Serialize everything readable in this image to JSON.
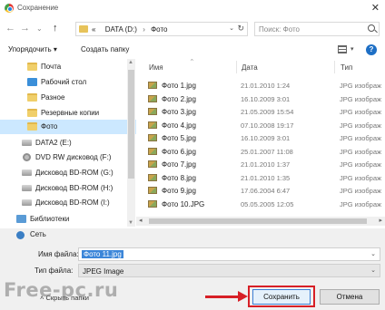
{
  "window": {
    "title": "Сохранение",
    "close_glyph": "✕"
  },
  "nav": {
    "back_glyph": "←",
    "forward_glyph": "→",
    "history_glyph": "⌄",
    "up_glyph": "↑",
    "address": {
      "prefix": "«",
      "segments": [
        "DATA (D:)",
        "Фото"
      ],
      "separator": "›",
      "dropdown_glyph": "⌄",
      "refresh_glyph": "↻"
    },
    "search_placeholder": "Поиск: Фото"
  },
  "commands": {
    "organize": "Упорядочить ▾",
    "new_folder": "Создать папку",
    "view_dropdown_glyph": "▾",
    "help": "?"
  },
  "tree": {
    "scroll_up": "▲",
    "scroll_down": "▼",
    "items": [
      {
        "label": "Почта",
        "icon": "folder-icon"
      },
      {
        "label": "Рабочий стол",
        "icon": "desktop-icon"
      },
      {
        "label": "Разное",
        "icon": "folder-icon"
      },
      {
        "label": "Резервные копии",
        "icon": "folder-icon"
      },
      {
        "label": "Фото",
        "icon": "folder-icon",
        "selected": true
      },
      {
        "label": "DATA2 (E:)",
        "icon": "drive-icon"
      },
      {
        "label": "DVD RW дисковод (F:)",
        "icon": "dvd-icon"
      },
      {
        "label": "Дисковод BD-ROM (G:)",
        "icon": "drive-icon"
      },
      {
        "label": "Дисковод BD-ROM (H:)",
        "icon": "drive-icon"
      },
      {
        "label": "Дисковод BD-ROM (I:)",
        "icon": "drive-icon"
      },
      {
        "label": "Библиотеки",
        "icon": "library-icon"
      },
      {
        "label": "Сеть",
        "icon": "network-icon"
      }
    ]
  },
  "files": {
    "columns": {
      "name": "Имя",
      "date": "Дата",
      "type": "Тип",
      "sort_glyph": "^"
    },
    "rows": [
      {
        "name": "Фото 1.jpg",
        "date": "21.01.2010 1:24",
        "type": "JPG изображ"
      },
      {
        "name": "Фото 2.jpg",
        "date": "16.10.2009 3:01",
        "type": "JPG изображ"
      },
      {
        "name": "Фото 3.jpg",
        "date": "21.05.2009 15:54",
        "type": "JPG изображ"
      },
      {
        "name": "Фото 4.jpg",
        "date": "07.10.2008 19:17",
        "type": "JPG изображ"
      },
      {
        "name": "Фото 5.jpg",
        "date": "16.10.2009 3:01",
        "type": "JPG изображ"
      },
      {
        "name": "Фото 6.jpg",
        "date": "25.01.2007 11:08",
        "type": "JPG изображ"
      },
      {
        "name": "Фото 7.jpg",
        "date": "21.01.2010 1:37",
        "type": "JPG изображ"
      },
      {
        "name": "Фото 8.jpg",
        "date": "21.01.2010 1:35",
        "type": "JPG изображ"
      },
      {
        "name": "Фото 9.jpg",
        "date": "17.06.2004 6:47",
        "type": "JPG изображ"
      },
      {
        "name": "Фото 10.JPG",
        "date": "05.05.2005 12:05",
        "type": "JPG изображ"
      }
    ],
    "hscroll_left": "◂",
    "hscroll_right": "▸"
  },
  "save": {
    "filename_label": "Имя файла:",
    "filename_value": "Фото 11.jpg",
    "filetype_label": "Тип файла:",
    "filetype_value": "JPEG Image",
    "dropdown_glyph": "⌄",
    "hide_folders": "˄ Скрыть папки",
    "save_button": "Сохранить",
    "cancel_button": "Отмена"
  },
  "watermark": "Free-pc.ru",
  "colors": {
    "highlight": "#d71f26",
    "selected_bg": "#cce8ff",
    "accent": "#3b86d9"
  }
}
